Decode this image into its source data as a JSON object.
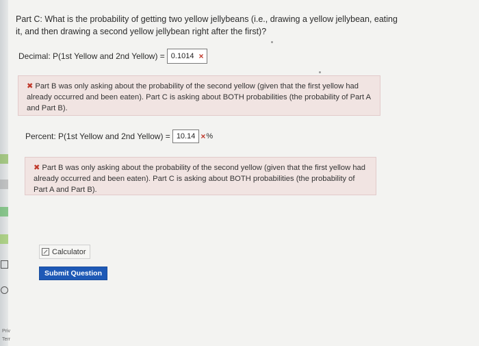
{
  "question": {
    "text": "Part C: What is the probability of getting two yellow jellybeans (i.e., drawing a yellow jellybean, eating it, and then drawing a second yellow jellybean right after the first)?"
  },
  "decimal": {
    "label": "Decimal: P(1st Yellow and 2nd Yellow) =",
    "value": "0.1014",
    "status": "×"
  },
  "feedback1": {
    "icon": "✖",
    "text": "Part B was only asking about the probability of the second yellow (given that the first yellow had already occurred and been eaten). Part C is asking about BOTH probabilities (the probability of Part A and Part B)."
  },
  "percent": {
    "label": "Percent: P(1st Yellow and 2nd Yellow) =",
    "value": "10.14",
    "status": "×",
    "suffix": "%"
  },
  "feedback2": {
    "icon": "✖",
    "text": "Part B was only asking about the probability of the second yellow (given that the first yellow had already occurred and been eaten). Part C is asking about BOTH probabilities (the probability of Part A and Part B)."
  },
  "buttons": {
    "calculator": "Calculator",
    "submit": "Submit Question"
  },
  "sidebar": {
    "footer1": "Priv",
    "footer2": "Terr"
  },
  "colors": {
    "error": "#c0392b",
    "submit_bg": "#1e59b6",
    "feedback_bg": "#f1e4e2"
  }
}
